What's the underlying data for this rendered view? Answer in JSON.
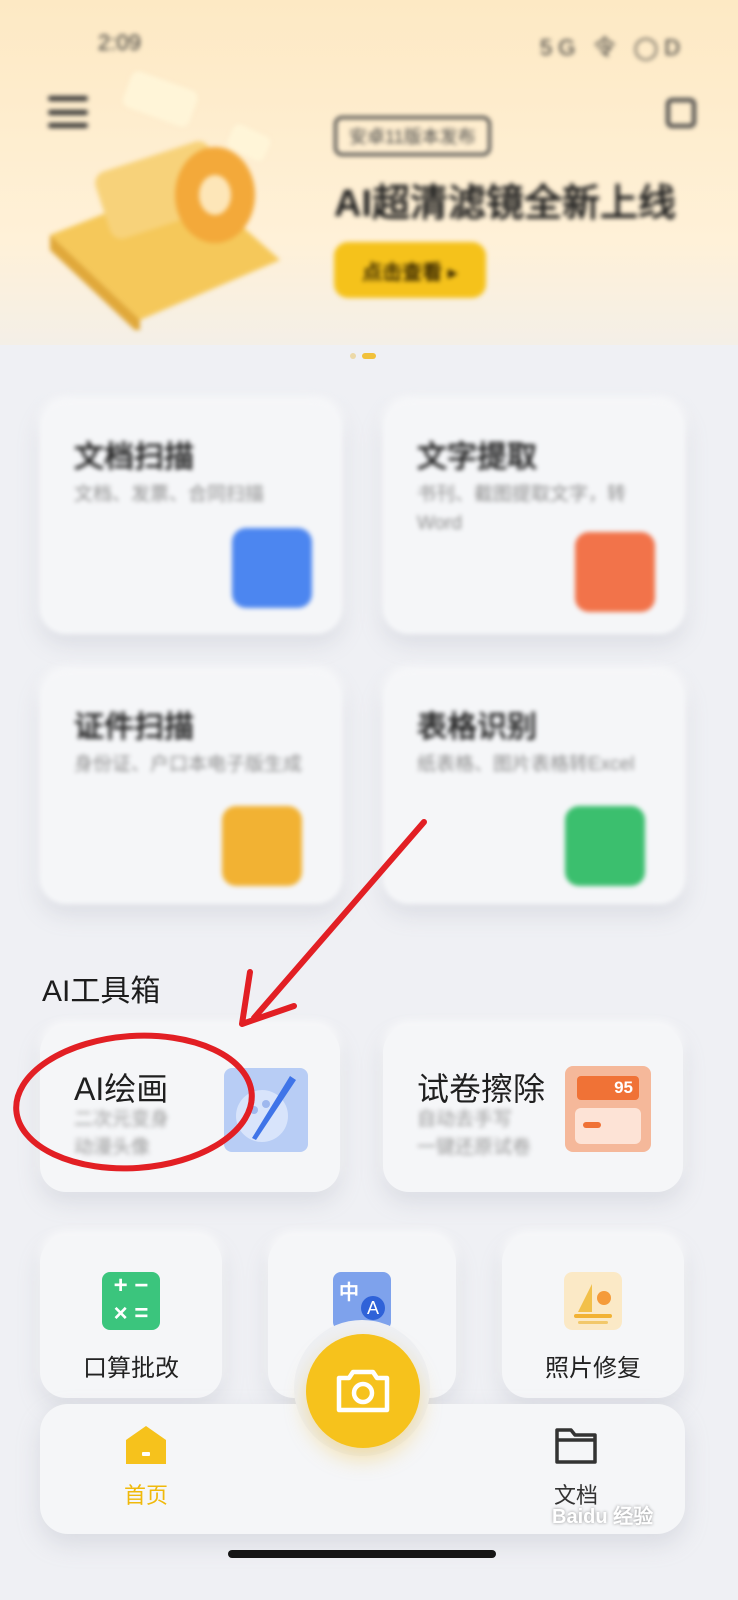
{
  "status_bar": {
    "time": "2:09",
    "right": "5G 令 ◯D"
  },
  "banner": {
    "badge": "安卓11版本发布",
    "headline": "AI超清滤镜全新上线",
    "cta": "点击查看 ▸"
  },
  "features": [
    {
      "title": "文档扫描",
      "subtitle": "文档、发票、合同扫描",
      "icon": "document-scan-icon",
      "color": "#4c86f0"
    },
    {
      "title": "文字提取",
      "subtitle": "书刊、截图提取文字，转Word",
      "icon": "text-extract-icon",
      "color": "#f2734a"
    },
    {
      "title": "证件扫描",
      "subtitle": "身份证、户口本电子版生成",
      "icon": "id-scan-icon",
      "color": "#f2b233"
    },
    {
      "title": "表格识别",
      "subtitle": "纸表格、图片表格转Excel",
      "icon": "table-recognize-icon",
      "color": "#3bbf6e"
    }
  ],
  "toolbox": {
    "title": "AI工具箱",
    "tools": [
      {
        "title": "AI绘画",
        "subtitle": "二次元变身\n动漫头像",
        "icon": "ai-painting-icon"
      },
      {
        "title": "试卷擦除",
        "subtitle": "自动去手写\n一键还原试卷",
        "icon": "exam-erase-icon",
        "badge": "95"
      }
    ],
    "small_tools": [
      {
        "label": "口算批改",
        "icon": "calculator-icon"
      },
      {
        "label": "",
        "icon": "translate-icon",
        "glyph": "中",
        "glyph2": "A"
      },
      {
        "label": "照片修复",
        "icon": "photo-repair-icon"
      }
    ]
  },
  "tabbar": {
    "home": "首页",
    "docs": "文档",
    "accent": "#f6c21c"
  },
  "watermark": "Baidu 经验"
}
